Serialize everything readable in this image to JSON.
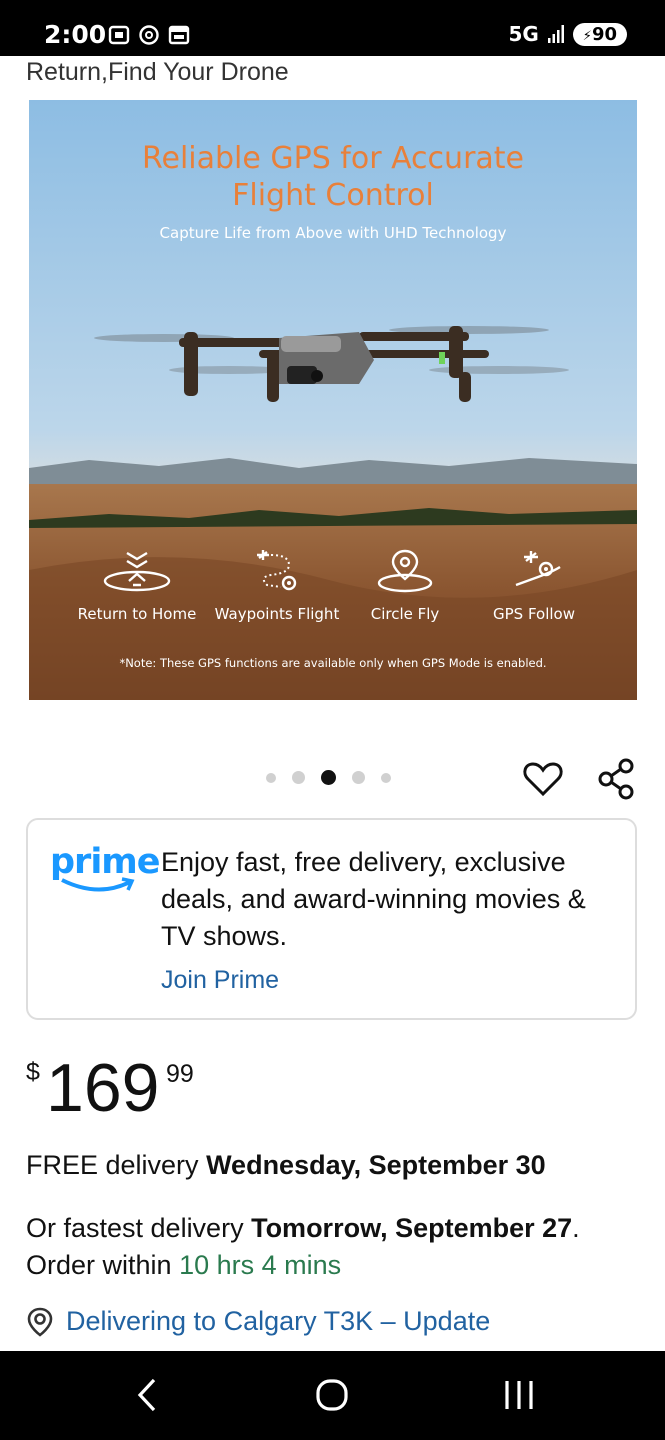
{
  "status_bar": {
    "time": "2:00",
    "network": "5G",
    "battery": "90"
  },
  "product": {
    "title_fragment": "Return,Find Your Drone"
  },
  "hero_image": {
    "title_line1": "Reliable GPS for Accurate",
    "title_line2": "Flight Control",
    "subtitle": "Capture Life from Above with UHD Technology",
    "features": [
      {
        "label": "Return to Home",
        "icon": "return-home-icon"
      },
      {
        "label": "Waypoints Flight",
        "icon": "waypoints-icon"
      },
      {
        "label": "Circle Fly",
        "icon": "circle-fly-icon"
      },
      {
        "label": "GPS Follow",
        "icon": "gps-follow-icon"
      }
    ],
    "note": "*Note: These GPS functions are available only when GPS Mode is enabled."
  },
  "carousel": {
    "total": 5,
    "active_index": 2
  },
  "prime": {
    "logo": "prime",
    "text": "Enjoy fast, free delivery, exclusive deals, and award-winning movies & TV shows.",
    "cta": "Join Prime",
    "accent": "#1a98ff"
  },
  "price": {
    "currency": "$",
    "whole": "169",
    "fraction": "99"
  },
  "delivery": {
    "free_prefix": "FREE delivery ",
    "free_date": "Wednesday, September 30",
    "fast_prefix": "Or fastest delivery ",
    "fast_date": "Tomorrow, September 27",
    "order_within_prefix": ". Order within ",
    "countdown": "10 hrs 4 mins",
    "location": "Delivering to Calgary T3K – Update"
  },
  "colors": {
    "link": "#2162a1",
    "countdown": "#2a7a4e",
    "hero_title": "#e8803a"
  }
}
